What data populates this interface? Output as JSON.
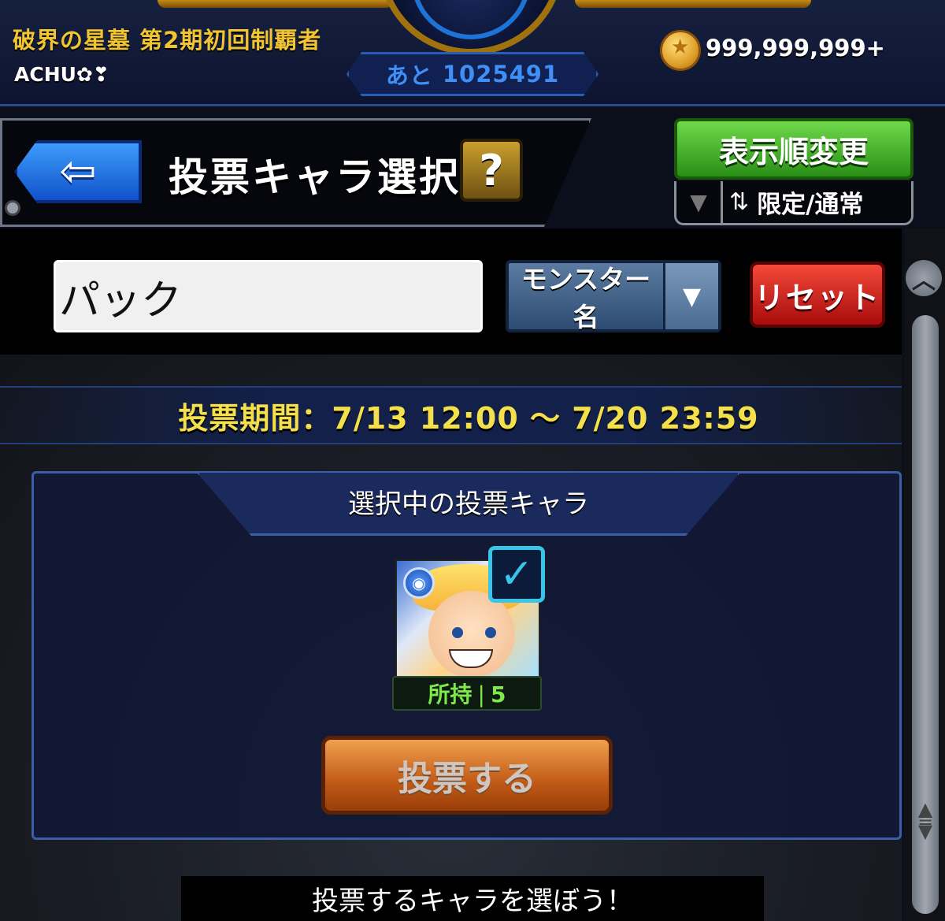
{
  "topbar": {
    "title": "破界の星墓 第2期初回制覇者",
    "player_name": "ACHU✿❣",
    "remaining_label": "あと",
    "remaining_value": "1025491",
    "coin_count": "999,999,999+"
  },
  "header": {
    "title": "投票キャラ選択",
    "help_label": "?",
    "back_icon": "back-arrow-icon",
    "sort_button": "表示順変更",
    "sort_mode": "限定/通常"
  },
  "search": {
    "value": "パック",
    "select_label": "モンスター名",
    "reset_label": "リセット"
  },
  "vote_period": "投票期間：7/13 12:00 ～ 7/20 23:59",
  "panel": {
    "title": "選択中の投票キャラ",
    "owned_label": "所持❘5",
    "vote_button": "投票する"
  },
  "footer_hint": "投票するキャラを選ぼう！",
  "colors": {
    "title_gold": "#f1c532",
    "period_yellow": "#f3e04c",
    "owned_green": "#7cea4a",
    "check_cyan": "#37c6ea"
  }
}
